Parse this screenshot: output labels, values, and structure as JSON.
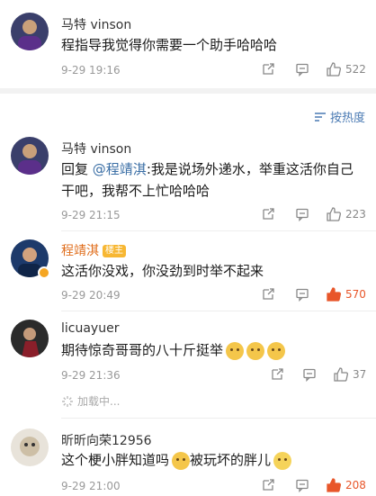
{
  "comments": [
    {
      "username": "马特 vinson",
      "text": "程指导我觉得你需要一个助手哈哈哈",
      "time": "9-29 19:16",
      "likes": "522",
      "avatar_color": "#3a3f6b"
    },
    {
      "username": "马特 vinson",
      "reply_prefix": "回复",
      "mention": "@程靖淇",
      "text": ":我是说场外递水，举重这活你自己干吧，我帮不上忙哈哈哈",
      "time": "9-29 21:15",
      "likes": "223",
      "avatar_color": "#3a3f6b"
    },
    {
      "username": "程靖淇",
      "owner_badge": "楼主",
      "text": "这活你没戏，你没劲到时举不起来",
      "time": "9-29 20:49",
      "likes": "570",
      "avatar_color": "#1d3a6b"
    },
    {
      "username": "licuayuer",
      "text": "期待惊奇哥哥的八十斤挺举",
      "time": "9-29 21:36",
      "likes": "37",
      "avatar_color": "#2b2b2b"
    },
    {
      "username": "昕昕向荣12956",
      "text": "这个梗小胖知道吗",
      "text_after": "被玩坏的胖儿",
      "time": "9-29 21:00",
      "likes": "208",
      "avatar_color": "#d9d2c5"
    }
  ],
  "sort_label": "按热度",
  "loading_label": "加载中...",
  "colors": {
    "liked": "#e8562a",
    "link": "#3a6ea5"
  }
}
